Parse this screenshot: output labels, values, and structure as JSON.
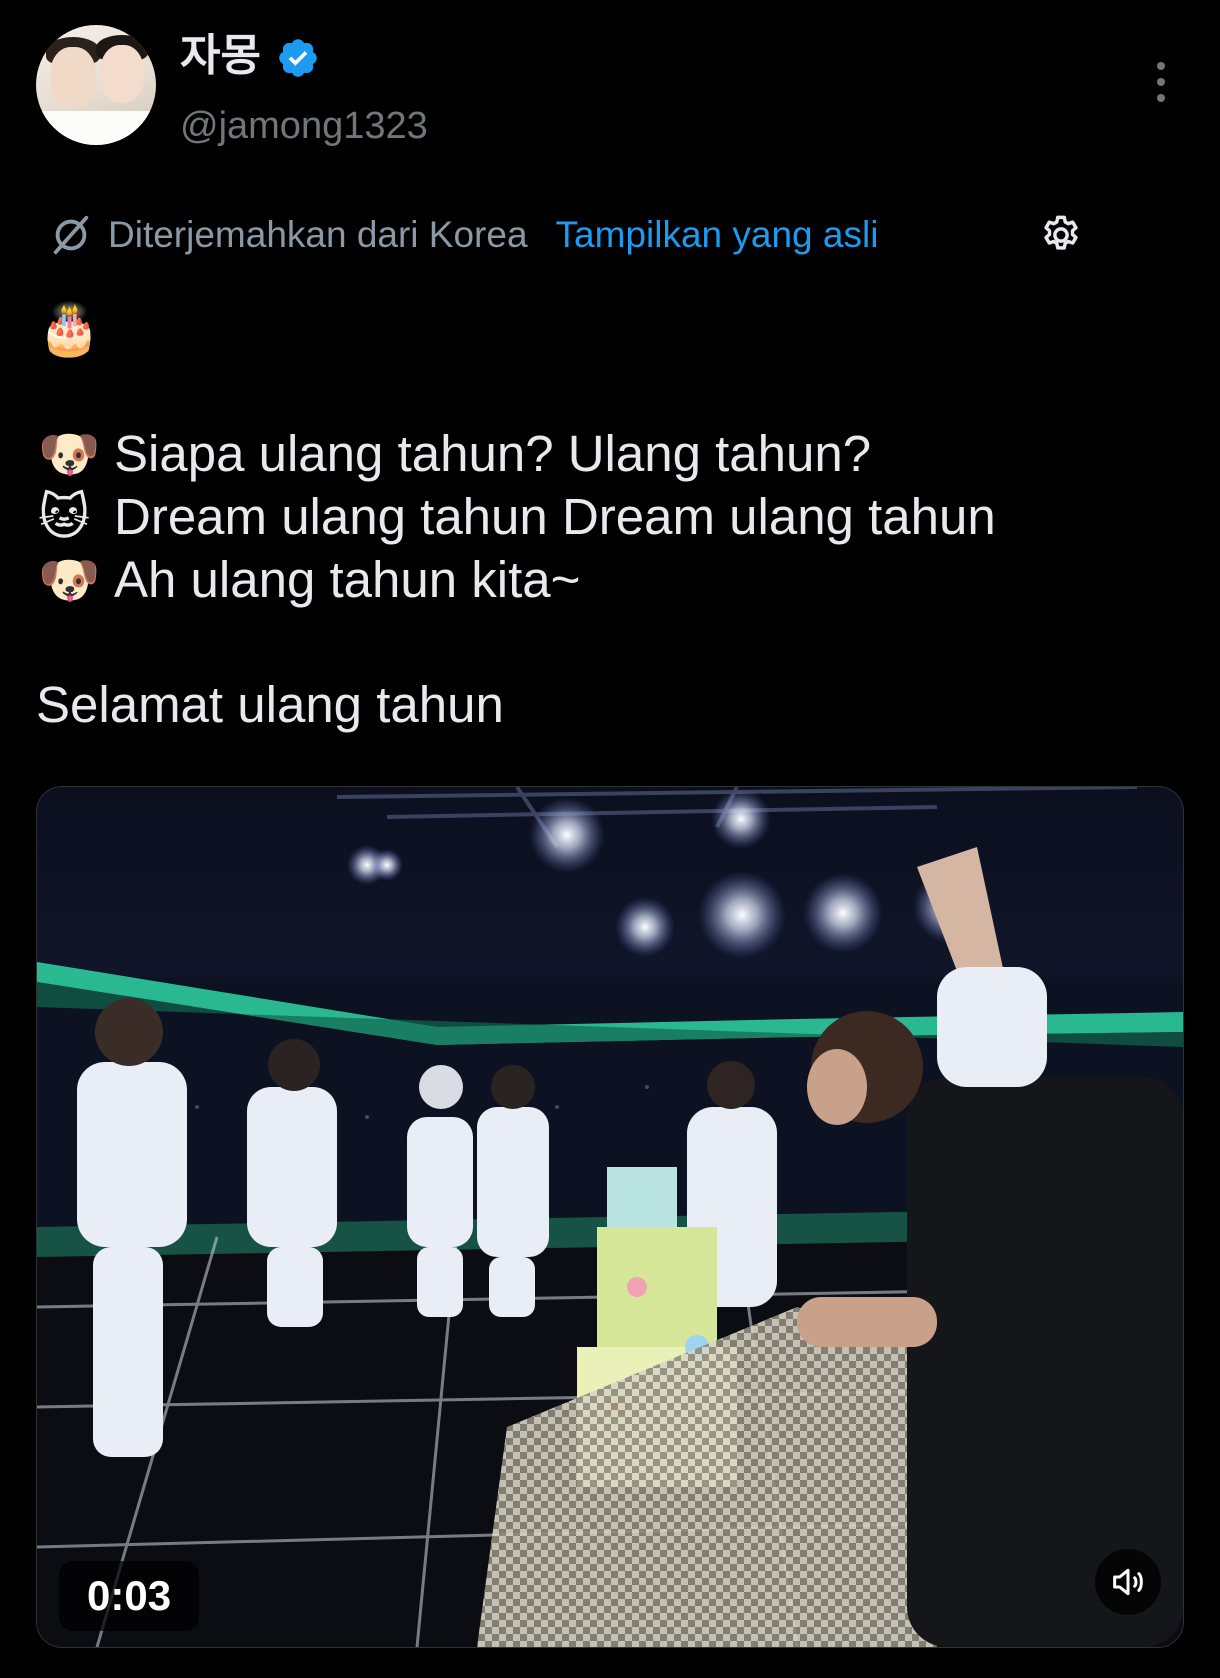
{
  "author": {
    "display_name": "자몽",
    "handle": "@jamong1323",
    "verified": true,
    "verified_color": "#1d9bf0"
  },
  "translation": {
    "translated_from": "Diterjemahkan dari Korea",
    "show_original": "Tampilkan yang asli"
  },
  "tweet": {
    "cake_emoji": "🎂",
    "lines": [
      {
        "emoji": "🐶",
        "text": "Siapa ulang tahun? Ulang tahun?"
      },
      {
        "emoji": "🐱",
        "text": "Dream ulang tahun Dream ulang tahun"
      },
      {
        "emoji": "🐶",
        "text": "Ah ulang tahun kita~"
      }
    ],
    "closing": "Selamat ulang tahun"
  },
  "video": {
    "time": "0:03",
    "mute_icon": "volume-muted-icon"
  },
  "colors": {
    "background": "#000000",
    "text": "#e7e9ea",
    "secondary": "#71767b",
    "link": "#1d9bf0",
    "stage_accent": "#2fd6a3"
  }
}
